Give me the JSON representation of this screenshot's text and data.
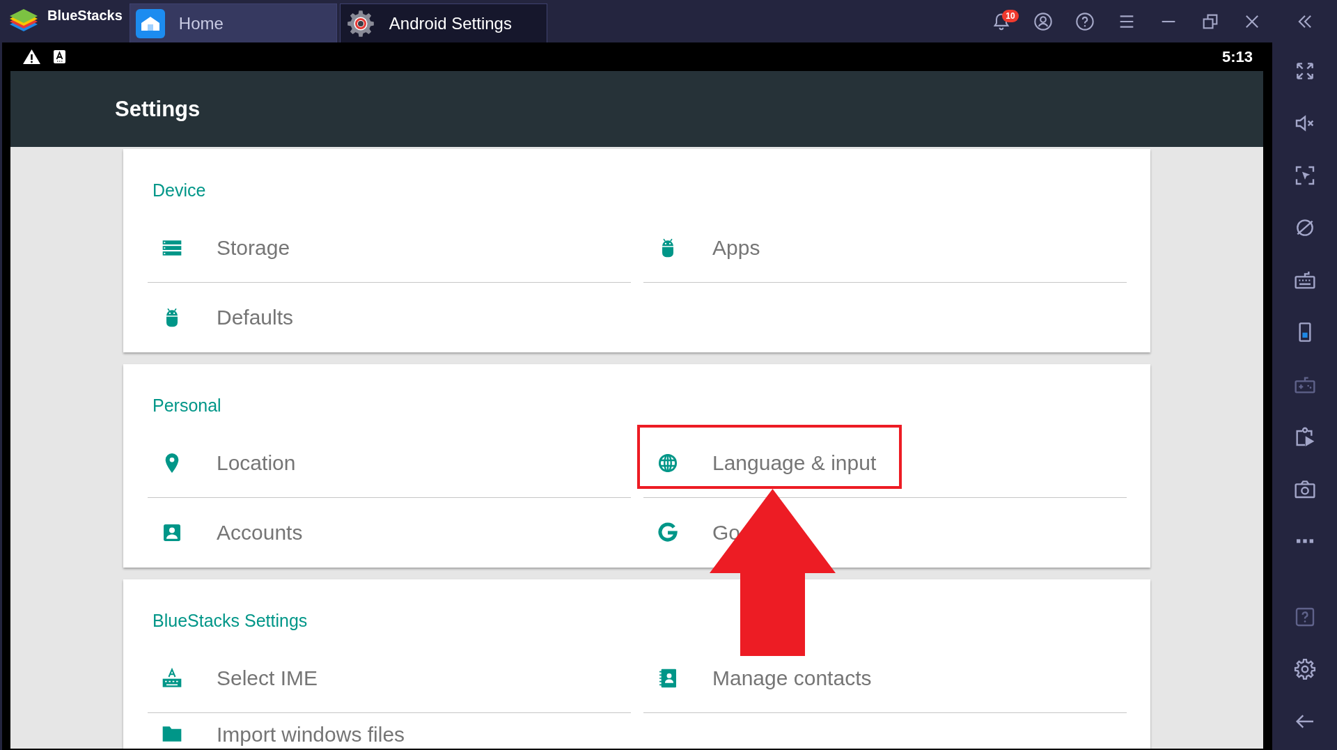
{
  "title_bar": {
    "app_name": "BlueStacks",
    "tabs": [
      {
        "label": "Home",
        "selected": false
      },
      {
        "label": "Android Settings",
        "selected": true
      }
    ],
    "notification_badge": "10"
  },
  "status_bar": {
    "time": "5:13"
  },
  "app_bar": {
    "title": "Settings"
  },
  "sections": [
    {
      "title": "Device",
      "items": [
        {
          "label": "Storage",
          "highlighted": false
        },
        {
          "label": "Apps",
          "highlighted": false
        },
        {
          "label": "Defaults",
          "highlighted": false
        }
      ]
    },
    {
      "title": "Personal",
      "items": [
        {
          "label": "Location",
          "highlighted": false
        },
        {
          "label": "Language & input",
          "highlighted": true
        },
        {
          "label": "Accounts",
          "highlighted": false
        },
        {
          "label": "Go",
          "highlighted": false
        }
      ]
    },
    {
      "title": "BlueStacks Settings",
      "items": [
        {
          "label": "Select IME",
          "highlighted": false
        },
        {
          "label": "Manage contacts",
          "highlighted": false
        },
        {
          "label": "Import windows files",
          "highlighted": false
        }
      ]
    }
  ],
  "sidebar": {
    "tools": [
      {
        "disabled": false
      },
      {
        "disabled": false
      },
      {
        "disabled": false
      },
      {
        "disabled": false
      },
      {
        "disabled": false
      },
      {
        "disabled": false
      },
      {
        "disabled": true
      },
      {
        "disabled": false
      },
      {
        "disabled": false
      },
      {
        "disabled": false
      },
      {
        "disabled": true
      },
      {
        "disabled": false
      },
      {
        "disabled": false
      }
    ]
  }
}
